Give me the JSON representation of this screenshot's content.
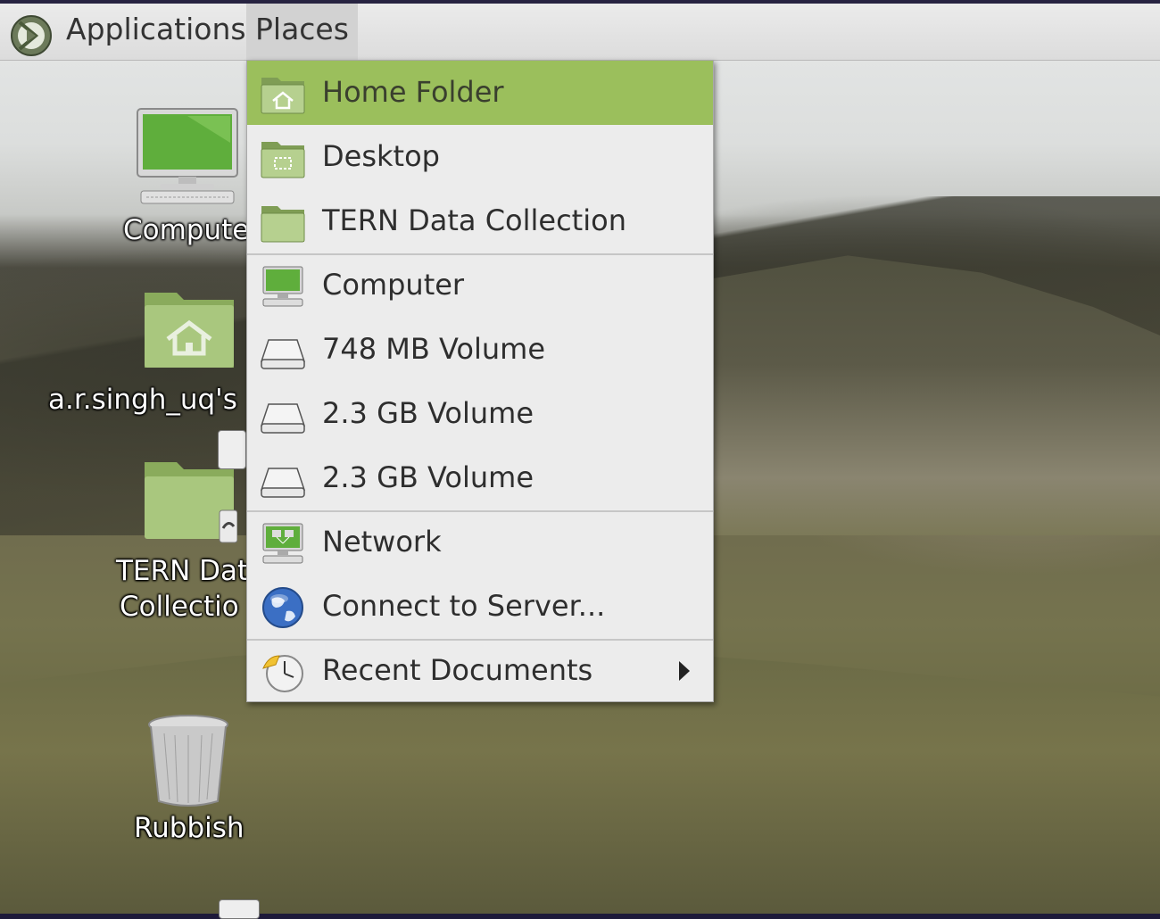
{
  "panel": {
    "logo_icon": "mint-logo-icon",
    "menus": [
      {
        "label": "Applications"
      },
      {
        "label": "Places"
      }
    ]
  },
  "desktop": {
    "icons": [
      {
        "label": "Compute",
        "icon": "computer-icon"
      },
      {
        "label": "a.r.singh_uq's",
        "icon": "home-folder-icon"
      },
      {
        "label": "TERN Dat",
        "label2": "Collectio",
        "icon": "folder-link-icon"
      },
      {
        "label": "Rubbish",
        "icon": "trash-icon"
      }
    ]
  },
  "places_menu": {
    "highlight_color": "#9bbf5c",
    "items": [
      {
        "label": "Home Folder",
        "icon": "home-folder-icon"
      },
      {
        "label": "Desktop",
        "icon": "desktop-folder-icon"
      },
      {
        "label": "TERN Data Collection",
        "icon": "folder-icon"
      },
      {
        "label": "Computer",
        "icon": "computer-icon"
      },
      {
        "label": "748 MB Volume",
        "icon": "drive-icon"
      },
      {
        "label": "2.3 GB Volume",
        "icon": "drive-icon"
      },
      {
        "label": "2.3 GB Volume",
        "icon": "drive-icon"
      },
      {
        "label": "Network",
        "icon": "network-icon"
      },
      {
        "label": "Connect to Server...",
        "icon": "globe-icon"
      },
      {
        "label": "Recent Documents",
        "icon": "recent-clock-icon"
      }
    ]
  }
}
